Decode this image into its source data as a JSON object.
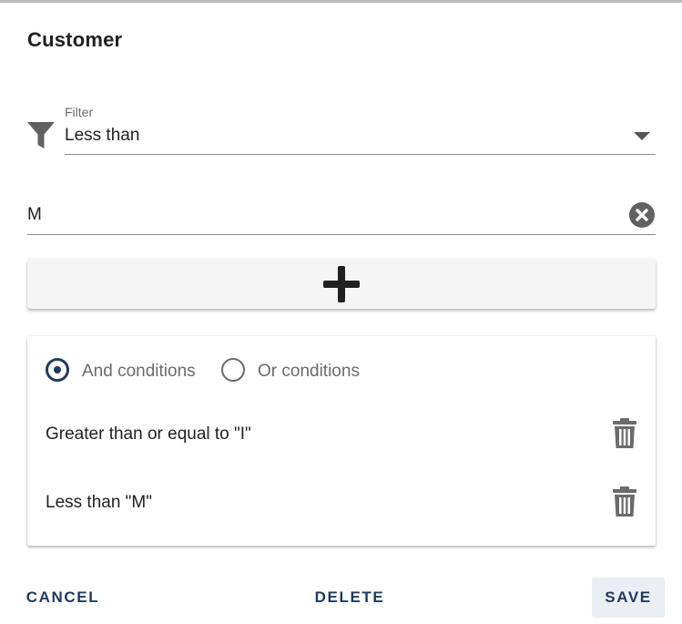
{
  "dialog": {
    "title": "Customer"
  },
  "filter": {
    "label": "Filter",
    "selected": "Less than",
    "icon": "funnel-icon"
  },
  "value_input": {
    "value": "M",
    "clear_icon": "clear-circle-icon"
  },
  "add_button": {
    "icon": "plus-icon"
  },
  "conditions": {
    "mode_options": [
      {
        "label": "And conditions",
        "selected": true
      },
      {
        "label": "Or conditions",
        "selected": false
      }
    ],
    "items": [
      {
        "text": "Greater than or equal to \"I\""
      },
      {
        "text": "Less than \"M\""
      }
    ]
  },
  "actions": {
    "cancel": "CANCEL",
    "delete": "DELETE",
    "save": "SAVE"
  },
  "colors": {
    "accent": "#1f3a5f",
    "icon_gray": "#616161",
    "save_bg": "#ebeef2"
  }
}
